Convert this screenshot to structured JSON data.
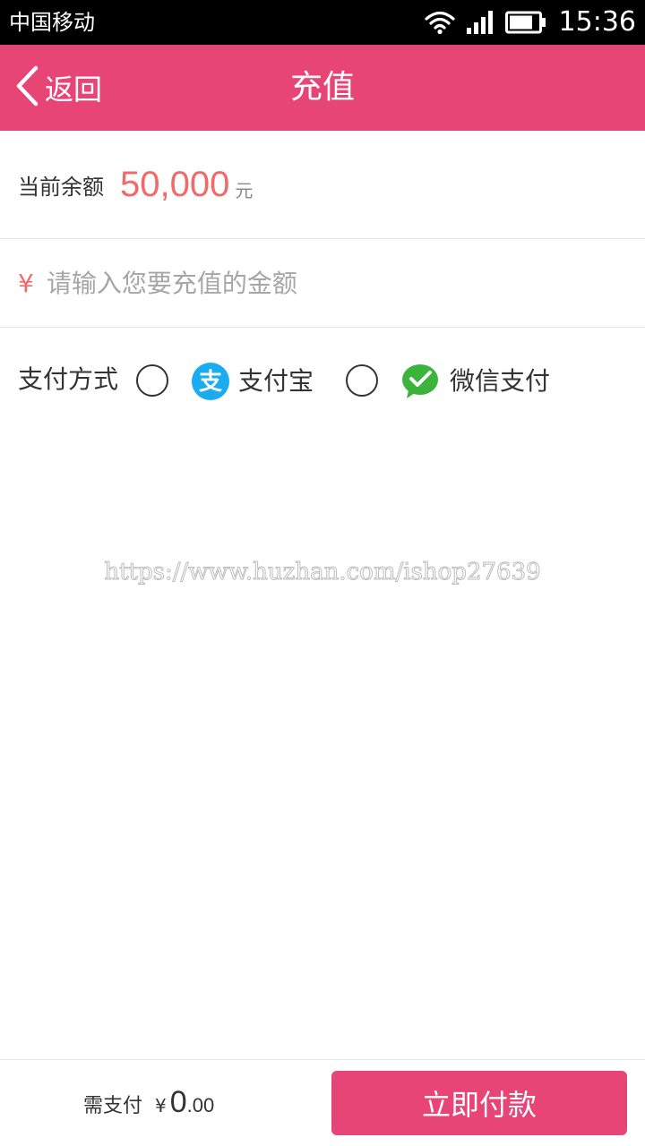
{
  "status_bar": {
    "carrier": "中国移动",
    "time": "15:36",
    "icons": [
      "wifi-icon",
      "signal-icon",
      "battery-icon"
    ]
  },
  "nav": {
    "back_label": "返回",
    "title": "充值",
    "background_color": "#e84577"
  },
  "balance": {
    "label": "当前余额",
    "value": "50,000",
    "unit": "元",
    "value_color": "#f06a6a"
  },
  "amount_input": {
    "currency_symbol": "¥",
    "value": "",
    "placeholder": "请输入您要充值的金额"
  },
  "payment": {
    "label": "支付方式",
    "options": [
      {
        "name": "支付宝",
        "icon": "alipay-icon",
        "icon_color": "#1aabf0",
        "selected": false
      },
      {
        "name": "微信支付",
        "icon": "wechat-pay-icon",
        "icon_color": "#3bb43b",
        "selected": false
      }
    ]
  },
  "watermark": "https://www.huzhan.com/ishop27639",
  "footer": {
    "need_pay_label": "需支付",
    "currency": "¥",
    "amount_int": "0",
    "amount_dec": ".00",
    "pay_button_label": "立即付款",
    "button_color": "#e84577"
  }
}
